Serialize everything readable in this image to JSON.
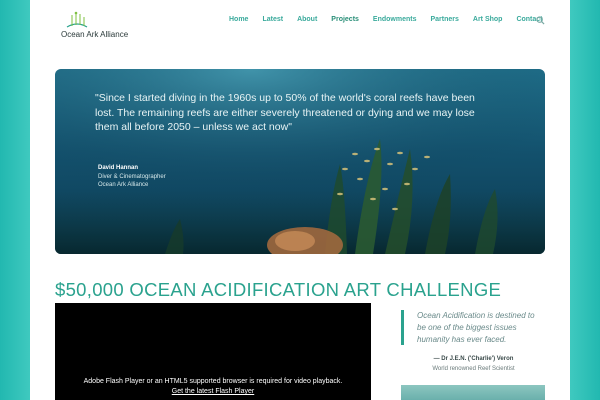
{
  "header": {
    "logo_text": "Ocean Ark Alliance",
    "nav": [
      "Home",
      "Latest",
      "About",
      "Projects",
      "Endowments",
      "Partners",
      "Art Shop",
      "Contact"
    ],
    "active_nav": "Projects"
  },
  "hero": {
    "quote": "\"Since I started diving in the 1960s up to 50% of the world's coral reefs have been lost. The remaining reefs are either severely threatened or dying and we may lose them all before 2050 – unless we act now\"",
    "author_name": "David Hannan",
    "author_role": "Diver & Cinematographer",
    "author_org": "Ocean Ark Alliance"
  },
  "challenge": {
    "title": "$50,000 OCEAN ACIDIFICATION ART CHALLENGE",
    "video_message": "Adobe Flash Player or an HTML5 supported browser is required for video playback.",
    "video_link": "Get the latest Flash Player"
  },
  "pullquote": {
    "text": "Ocean Acidification is destined to be one of the biggest issues humanity has ever faced.",
    "author": "— Dr J.E.N. ('Charlie') Veron",
    "author_role": "World renowned Reef Scientist"
  },
  "colors": {
    "accent": "#2aa28e",
    "nav": "#3aaa9c",
    "side": "#3fc9bf"
  }
}
